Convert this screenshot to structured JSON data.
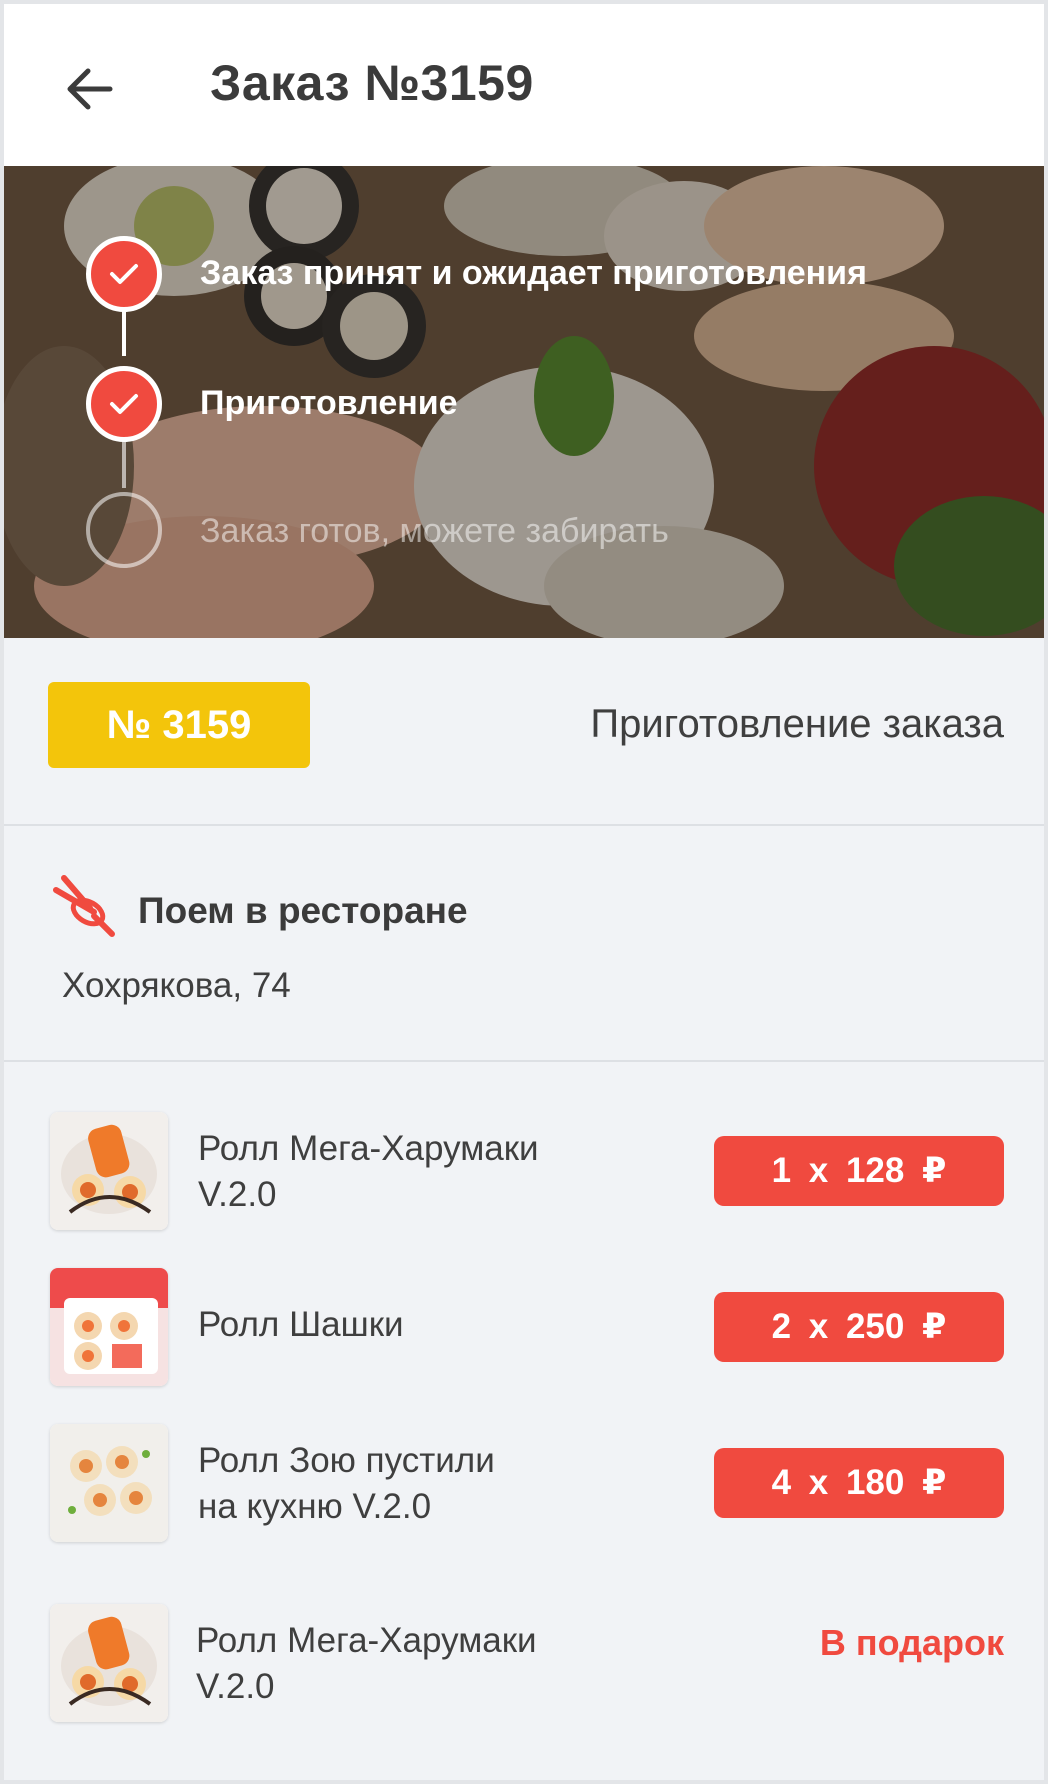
{
  "header": {
    "title": "Заказ №3159"
  },
  "progress": {
    "steps": [
      {
        "label": "Заказ принят и ожидает приготовления",
        "done": true
      },
      {
        "label": "Приготовление",
        "done": true
      },
      {
        "label": "Заказ готов, можете забирать",
        "done": false
      }
    ]
  },
  "status": {
    "badge": "№ 3159",
    "text": "Приготовление заказа"
  },
  "location": {
    "title": "Поем в ресторане",
    "address": "Хохрякова, 74",
    "icon": "chopsticks-icon"
  },
  "items": [
    {
      "name": "Ролл Мега-Харумаки\n V.2.0",
      "price": "1  x  128 ₽"
    },
    {
      "name": "Ролл Шашки",
      "price": "2  x  250 ₽"
    },
    {
      "name": "Ролл Зою пустили\nна кухню V.2.0",
      "price": "4  x  180 ₽"
    },
    {
      "name": "Ролл Мега-Харумаки\n V.2.0",
      "gift": "В подарок"
    }
  ],
  "colors": {
    "accent": "#f04a3f",
    "badge": "#f3c50b",
    "background": "#f1f3f6"
  }
}
